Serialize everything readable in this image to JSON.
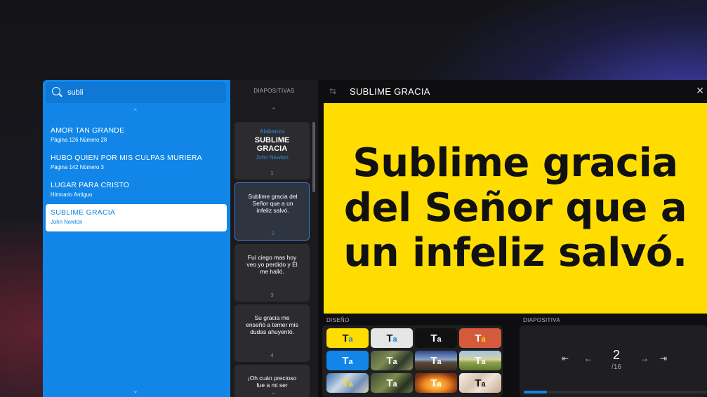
{
  "search": {
    "value": "subli"
  },
  "songs": [
    {
      "title": "AMOR TAN GRANDE",
      "subtitle": "Página 126 Número 28"
    },
    {
      "title": "HUBO QUIEN POR MIS CULPAS MURIERA",
      "subtitle": "Página 142 Número 3"
    },
    {
      "title": "LUGAR PARA CRISTO",
      "subtitle": "Himnario Antiguo"
    },
    {
      "title": "SUBLIME GRACIA",
      "subtitle": "John Newton",
      "selected": true
    }
  ],
  "slides_header": "DIAPOSITIVAS",
  "slides": [
    {
      "category": "Alabanza",
      "title": "SUBLIME GRACIA",
      "author": "John Newton",
      "number": "1"
    },
    {
      "text": "Sublime gracia del Señor que a un infeliz salvó.",
      "number": "2",
      "active": true
    },
    {
      "text": "Fuí ciego mas hoy veo yo perdido y Él me halló.",
      "number": "3"
    },
    {
      "text": "Su gracia me enseñó a temer mis dudas ahuyentó.",
      "number": "4"
    },
    {
      "text": "¡Oh cuán precioso fue a mi ser"
    }
  ],
  "preview": {
    "title": "SUBLIME GRACIA",
    "slide_text": "Sublime gracia del Señor que a un infeliz salvó.",
    "background_color": "#ffdd00"
  },
  "design_label": "DISEÑO",
  "diapositiva_label": "DIAPOSITIVA",
  "theme_glyph": "T",
  "theme_glyph_small": "a",
  "themes": [
    {
      "name": "yellow"
    },
    {
      "name": "light-gray"
    },
    {
      "name": "black"
    },
    {
      "name": "red"
    },
    {
      "name": "blue"
    },
    {
      "name": "landscape-1"
    },
    {
      "name": "landscape-2"
    },
    {
      "name": "landscape-3"
    },
    {
      "name": "landscape-4"
    },
    {
      "name": "landscape-5"
    },
    {
      "name": "landscape-6"
    },
    {
      "name": "landscape-7"
    }
  ],
  "navigation": {
    "current": "2",
    "total": "/16",
    "progress": 0.125
  },
  "colors": {
    "accent": "#1186e8",
    "slide_bg": "#ffdd00"
  }
}
